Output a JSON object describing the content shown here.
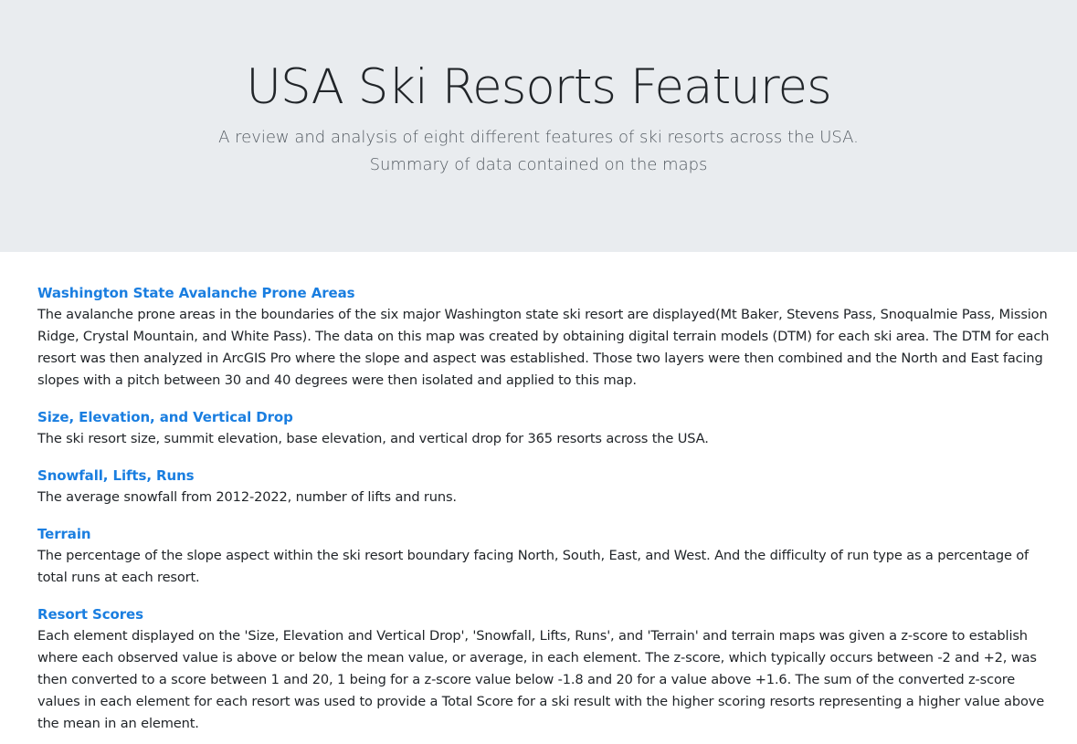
{
  "header": {
    "title": "USA Ski Resorts Features",
    "subtitle_line1": "A review and analysis of eight different features of ski resorts across the USA.",
    "subtitle_line2": "Summary of data contained on the maps"
  },
  "sections": [
    {
      "title": "Washington State Avalanche Prone Areas",
      "body": "The avalanche prone areas in the boundaries of the six major Washington state ski resort are displayed(Mt Baker, Stevens Pass, Snoqualmie Pass, Mission Ridge, Crystal Mountain, and White Pass). The data on this map was created by obtaining digital terrain models (DTM) for each ski area. The DTM for each resort was then analyzed in ArcGIS Pro where the slope and aspect was established. Those two layers were then combined and the North and East facing slopes with a pitch between 30 and 40 degrees were then isolated and applied to this map."
    },
    {
      "title": "Size, Elevation, and Vertical Drop",
      "body": "The ski resort size, summit elevation, base elevation, and vertical drop for 365 resorts across the USA."
    },
    {
      "title": "Snowfall, Lifts, Runs",
      "body": "The average snowfall from 2012-2022, number of lifts and runs."
    },
    {
      "title": "Terrain",
      "body": "The percentage of the slope aspect within the ski resort boundary facing North, South, East, and West. And the difficulty of run type as a percentage of total runs at each resort."
    },
    {
      "title": "Resort Scores",
      "body": "Each element displayed on the 'Size, Elevation and Vertical Drop', 'Snowfall, Lifts, Runs', and 'Terrain' and terrain maps was given a z-score to establish where each observed value is above or below the mean value, or average, in each element. The z-score, which typically occurs between -2 and +2, was then converted to a score between 1 and 20, 1 being for a z-score value below -1.8 and 20 for a value above +1.6. The sum of the converted z-score values in each element for each resort was used to provide a Total Score for a ski result with the higher scoring resorts representing a higher value above the mean in an element."
    }
  ]
}
